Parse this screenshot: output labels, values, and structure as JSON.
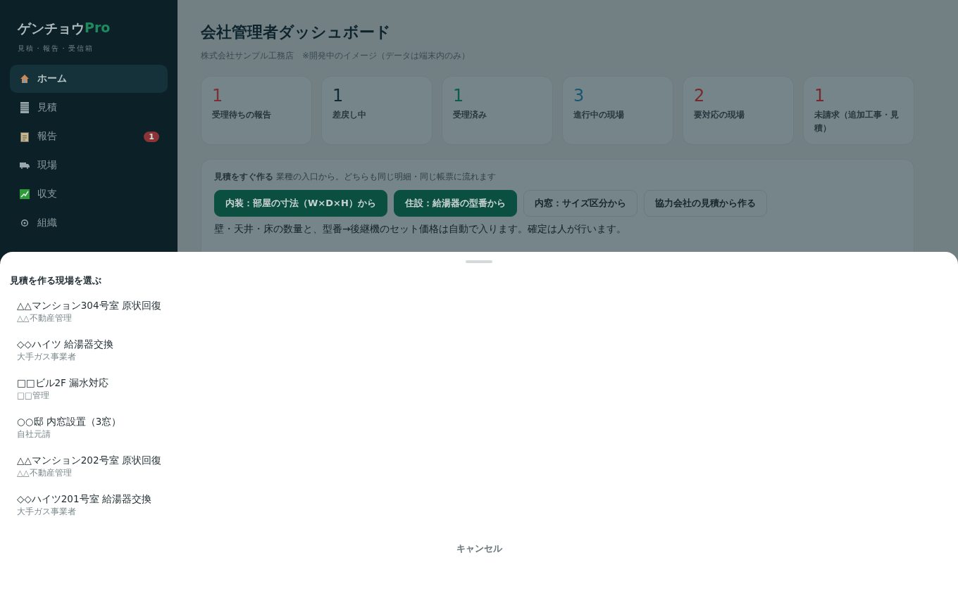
{
  "sidebar": {
    "logo": {
      "name": "ゲンチョウ",
      "suffix": "Pro"
    },
    "tagline": "見積・報告・受信箱",
    "items": [
      {
        "label": "ホーム",
        "selected": true
      },
      {
        "label": "見積",
        "selected": false
      },
      {
        "label": "報告",
        "selected": false,
        "badge": "1"
      },
      {
        "label": "現場",
        "selected": false
      },
      {
        "label": "収支",
        "selected": false
      },
      {
        "label": "組織",
        "selected": false
      }
    ]
  },
  "main": {
    "title": "会社管理者ダッシュボード",
    "subtitle": "株式会社サンプル工務店　※開発中のイメージ（データは端末内のみ）",
    "stats": [
      {
        "value": "1",
        "label": "受理待ちの報告",
        "color": "#7a3034"
      },
      {
        "value": "1",
        "label": "差戻し中",
        "color": "#0f2a33"
      },
      {
        "value": "1",
        "label": "受理済み",
        "color": "#0d5c48"
      },
      {
        "value": "3",
        "label": "進行中の現場",
        "color": "#175670"
      },
      {
        "value": "2",
        "label": "要対応の現場",
        "color": "#772a2e"
      },
      {
        "value": "1",
        "label": "未請求（追加工事・見積）",
        "color": "#772a2e"
      }
    ],
    "quick": {
      "heading": "**見積をすぐ作る** 業種の入口から。どちらも同じ明細・同じ帳票に流れます",
      "buttons": [
        {
          "label": "内装：部屋の寸法（W×D×H）から",
          "kind": "primary"
        },
        {
          "label": "住設：給湯器の型番から",
          "kind": "primary"
        },
        {
          "label": "内窓：サイズ区分から",
          "kind": "outline"
        },
        {
          "label": "協力会社の見積から作る",
          "kind": "outline"
        }
      ],
      "note": "壁・天井・床の数量と、型番→後継機のセット価格は自動で入ります。確定は人が行います。"
    }
  },
  "sheet": {
    "title": "見積を作る現場を選ぶ",
    "sites": [
      {
        "name": "△△マンション304号室 原状回復",
        "client": "△△不動産管理"
      },
      {
        "name": "◇◇ハイツ 給湯器交換",
        "client": "大手ガス事業者"
      },
      {
        "name": "□□ビル2F 漏水対応",
        "client": "□□管理"
      },
      {
        "name": "○○邸 内窓設置（3窓）",
        "client": "自社元請"
      },
      {
        "name": "△△マンション202号室 原状回復",
        "client": "△△不動産管理"
      },
      {
        "name": "◇◇ハイツ201号室 給湯器交換",
        "client": "大手ガス事業者"
      }
    ],
    "cancel": "キャンセル"
  }
}
